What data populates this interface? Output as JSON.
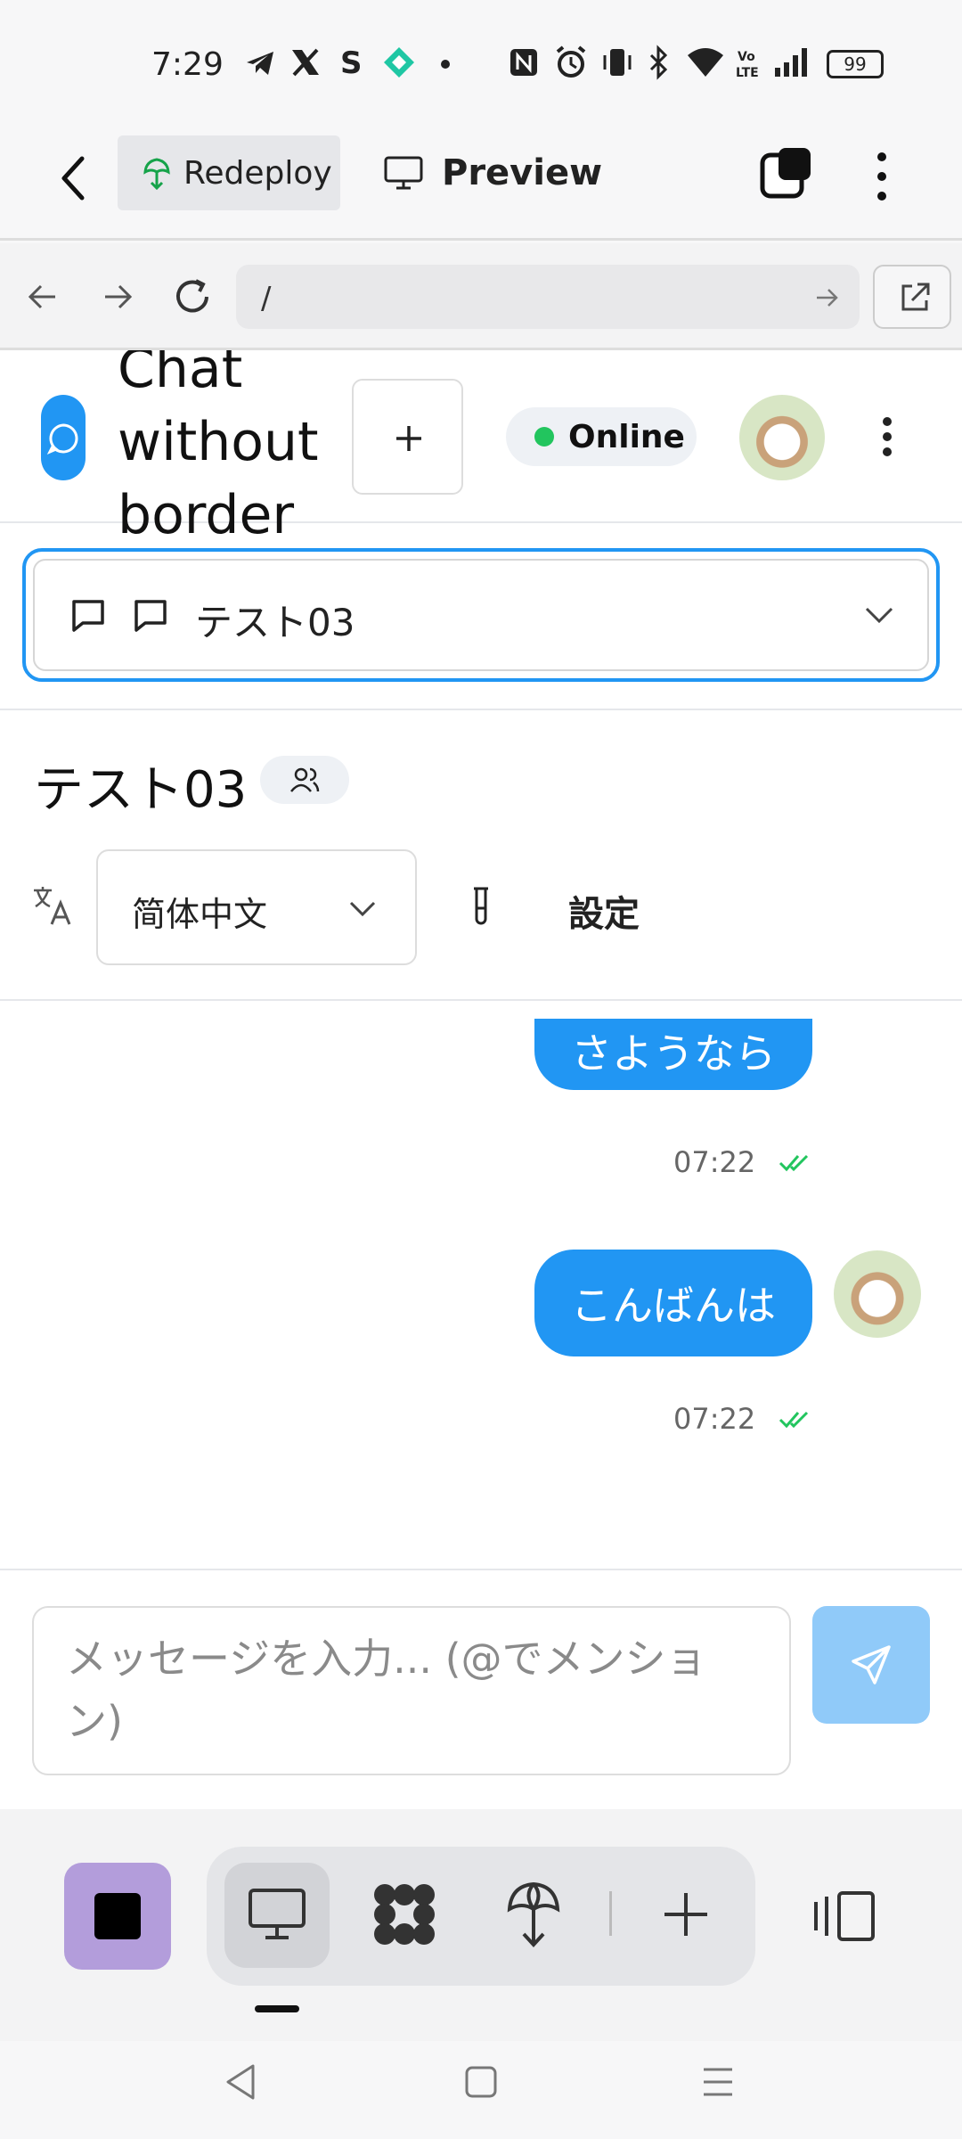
{
  "status_bar": {
    "time": "7:29",
    "battery": "99",
    "network": "VoLTE"
  },
  "app_toolbar": {
    "redeploy_label": "Redeploy",
    "preview_label": "Preview"
  },
  "browser": {
    "url": "/"
  },
  "chat_header": {
    "title": "Chat without border",
    "status": "Online"
  },
  "room_select": {
    "selected": "テスト03"
  },
  "room": {
    "title": "テスト03",
    "language": "简体中文",
    "settings_label": "設定"
  },
  "messages": [
    {
      "text": "さようなら",
      "time": "07:22"
    },
    {
      "text": "こんばんは",
      "time": "07:22"
    }
  ],
  "composer": {
    "placeholder": "メッセージを入力... (@でメンション)"
  },
  "colors": {
    "accent": "#2196f3",
    "online": "#22c55e",
    "send_disabled": "#90caf9",
    "stop_button": "#b39ddb"
  }
}
